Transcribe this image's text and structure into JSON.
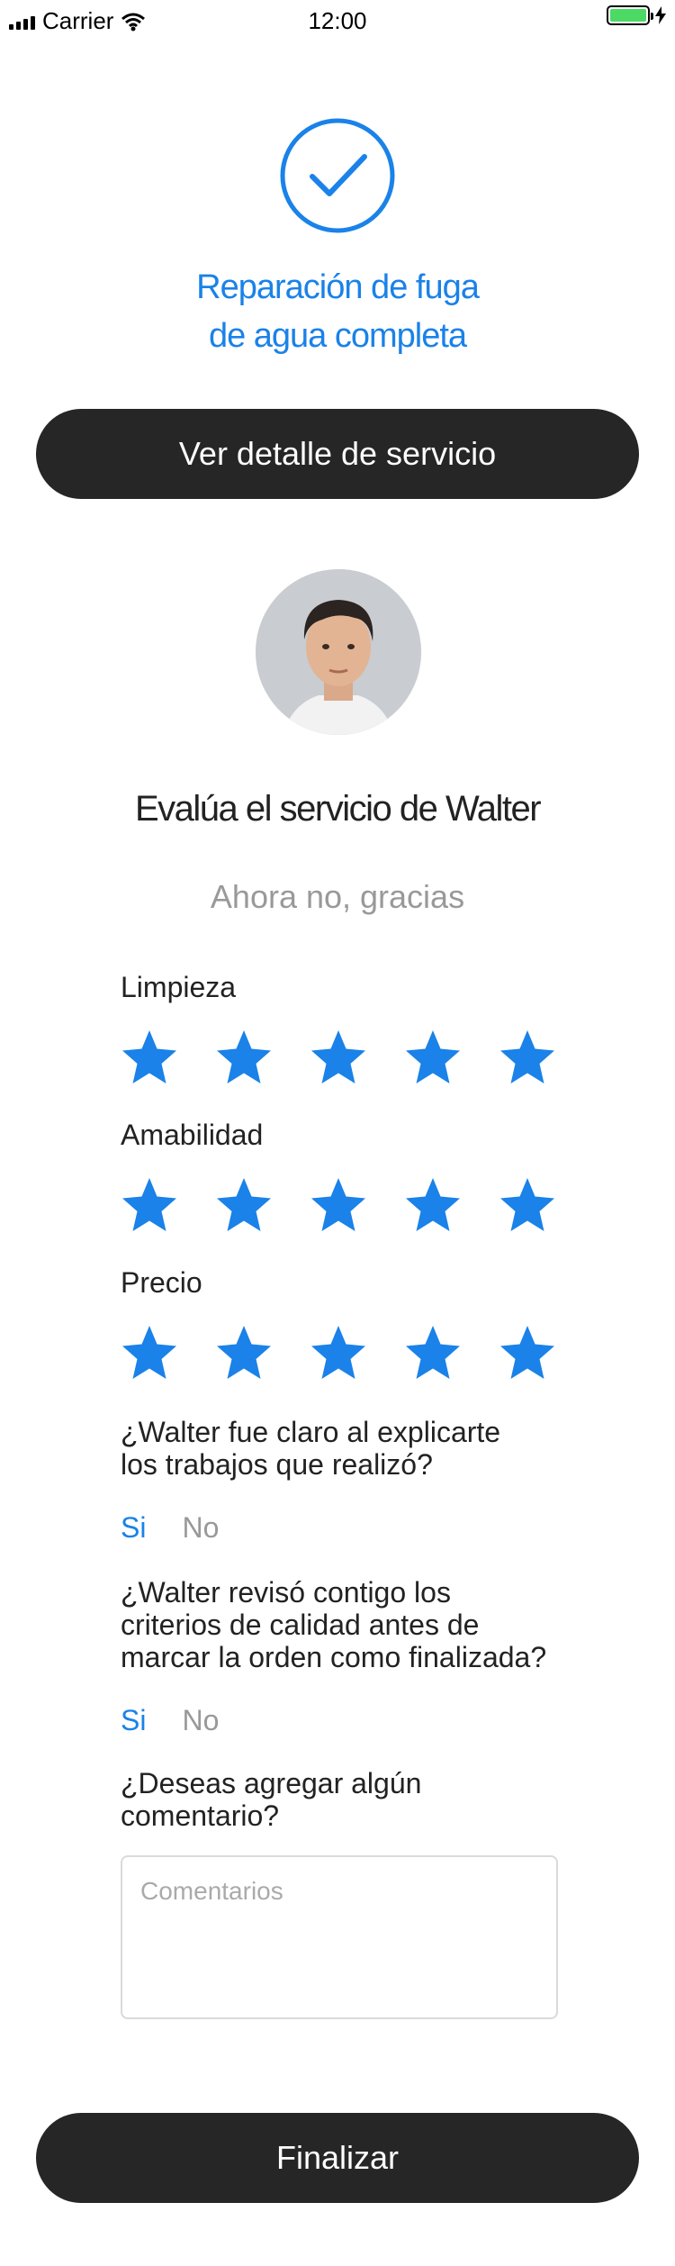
{
  "status_bar": {
    "carrier": "Carrier",
    "time": "12:00",
    "battery_color": "#4cd964"
  },
  "header": {
    "icon": "check-circle-icon",
    "title_line1": "Reparación de fuga",
    "title_line2": "de agua completa",
    "accent_color": "#1a82e8"
  },
  "detail_button": {
    "label": "Ver detalle de servicio"
  },
  "provider": {
    "avatar": "avatar-photo",
    "rate_title": "Evalúa el servicio de Walter",
    "skip_label": "Ahora no, gracias"
  },
  "ratings": [
    {
      "label": "Limpieza",
      "stars": 5,
      "max": 5
    },
    {
      "label": "Amabilidad",
      "stars": 5,
      "max": 5
    },
    {
      "label": "Precio",
      "stars": 5,
      "max": 5
    }
  ],
  "questions": [
    {
      "line1": "¿Walter fue claro al explicarte",
      "line2": "los trabajos que realizó?",
      "yes": "Si",
      "no": "No"
    },
    {
      "line1": "¿Walter revisó contigo los",
      "line2": "criterios de calidad antes de",
      "line3": "marcar la orden como finalizada?",
      "yes": "Si",
      "no": "No"
    }
  ],
  "comment": {
    "line1": "¿Deseas agregar algún",
    "line2": "comentario?",
    "placeholder": "Comentarios",
    "value": ""
  },
  "finish_button": {
    "label": "Finalizar"
  }
}
